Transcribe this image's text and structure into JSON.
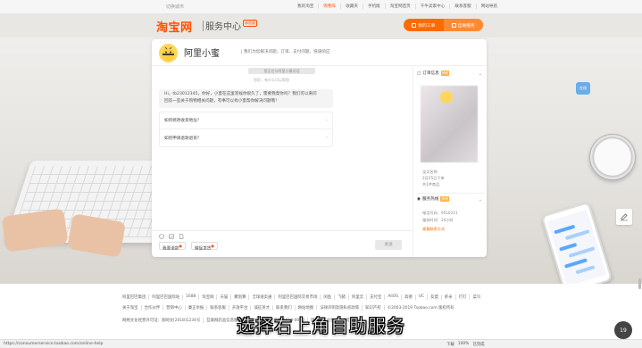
{
  "topbar": {
    "city": "切换城市",
    "links": [
      "我的淘宝",
      "购物车",
      "收藏夹",
      "手机版",
      "淘宝网首页",
      "千牛卖家中心",
      "联系客服",
      "网站导航"
    ]
  },
  "header": {
    "logo_text": "淘宝网",
    "subtitle": "服务中心",
    "beta": "体验版",
    "buttons": [
      {
        "label": "我的工单",
        "state": "normal"
      },
      {
        "label": "自助服务",
        "state": "active"
      }
    ]
  },
  "bot": {
    "name": "阿里小蜜",
    "desc": "| 我们为您解决问题，订单、支付问题，快速响应"
  },
  "chat": {
    "sys_chip": "您正在与阿里小蜜对话",
    "sys_sub": "您好，有什么可以帮您",
    "greeting_line1": "Hi，tb23012345，你好，小蜜在这里等候你很久了，需要我帮你吗？我们可以来问",
    "greeting_line2": "回答一些关于购物相关问题，有事可以找小蜜帮你解决问题哦！",
    "faq": [
      {
        "question": "如何修改收货地址？"
      },
      {
        "question": "如何申请退款退货？"
      }
    ],
    "quick_replies": [
      "我要退款",
      "催促发货"
    ],
    "send_label": "发送",
    "tool_icons": [
      "emoji-icon",
      "image-icon",
      "file-icon"
    ]
  },
  "side": {
    "order_title": "订单信息",
    "order_badge": "待收",
    "order_lines": [
      "宝贝名称",
      "2月25日下单",
      "共1件商品"
    ],
    "service_title": "服务热线",
    "service_badge": "热线",
    "service_lines": [
      "电话号码：9510211",
      "服务时间：24小时",
      "查看联系方式"
    ]
  },
  "footer": {
    "row1": [
      "阿里巴巴集团",
      "阿里巴巴国际站",
      "1688",
      "淘宝网",
      "天猫",
      "聚划算",
      "全球速卖通",
      "阿里巴巴国际交易市场",
      "闲鱼",
      "飞猪",
      "阿里云",
      "支付宝",
      "AliOS",
      "高德",
      "UC",
      "友盟",
      "虾米",
      "钉钉",
      "菜鸟"
    ],
    "row2": [
      "关于淘宝",
      "合作伙伴",
      "营销中心",
      "廉正举报",
      "联系客服",
      "开放平台",
      "诚征英才",
      "联系我们",
      "网站地图",
      "法律声明及隐私权政策",
      "知识产权",
      "©2003-2019 Taobao.com 版权所有"
    ],
    "row3": [
      "网络文化经营许可证：浙网文[2018]1234号",
      "互联网药品信息服务资格证书：(浙)-经营性-2018-0000",
      "增值电信业务经营许可证"
    ]
  },
  "subtitle_text": "选择右上角自助服务",
  "statusbar": {
    "url": "https://consumerservice.taobao.com/online-help",
    "items": [
      "下载",
      "100%",
      "已完成"
    ]
  },
  "corner_badge": "19",
  "side_float": "在线"
}
